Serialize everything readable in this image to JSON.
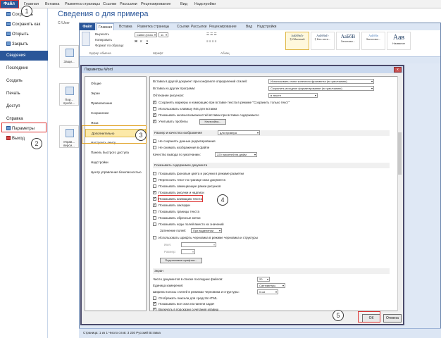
{
  "outer": {
    "file_tab": "Файл",
    "tabs": [
      "Главная",
      "Вставка",
      "Разметка страницы",
      "Ссылки",
      "Рассылки",
      "Рецензирование",
      "Вид",
      "Надстройки"
    ],
    "title": "Сведения о для примера",
    "path": "C:\\User",
    "nav": [
      "Сохранить",
      "Сохранить как",
      "Открыть",
      "Закрыть",
      "Сведения",
      "Последние",
      "Создать",
      "Печать",
      "Доступ",
      "Справка",
      "Параметры",
      "Выход"
    ],
    "cards": [
      "Защи...",
      "Пои... пробл...",
      "Управ... верси..."
    ]
  },
  "inner": {
    "file_tab": "Файл",
    "tabs": [
      "Главная",
      "Вставка",
      "Разметка страницы",
      "Ссылки",
      "Рассылки",
      "Рецензирование",
      "Вид",
      "Надстройки"
    ],
    "ribbon": {
      "cut": "Вырезать",
      "copy": "Копировать",
      "format_painter": "Формат по образцу",
      "font": "Calibri (Осно",
      "size": "11",
      "group_clipboard": "Буфер обмена",
      "group_font": "Шрифт",
      "group_paragraph": "Абзац",
      "styles": [
        {
          "sample": "АаБбВвГг",
          "name": "¶ Обычный"
        },
        {
          "sample": "АаБбВвГг",
          "name": "¶ Без инте..."
        },
        {
          "sample": "АаБбВ",
          "name": "Заголово..."
        },
        {
          "sample": "АаБбВв",
          "name": "Заголово..."
        },
        {
          "sample": "Аав",
          "name": "Название"
        }
      ]
    },
    "status": "Страница: 1 из 1    Число слов: 3 230    Русский    Вставка"
  },
  "dialog": {
    "title": "Параметры Word",
    "close": "x",
    "left_items": [
      "Общие",
      "Экран",
      "Правописание",
      "Сохранение",
      "Язык",
      "Дополнительно",
      "Настроить ленту",
      "Панель быстрого доступа",
      "Надстройки",
      "Центр управления безопасностью"
    ],
    "rows_top": [
      {
        "text": "Вставка в другой документ при конфликте определений стилей:",
        "dd": "Использовать стили конечного фрагмента (по умолчанию)",
        "checked": null
      },
      {
        "text": "Вставка из других программ:",
        "dd": "Сохранить исходное форматирование (по умолчанию)",
        "checked": null
      },
      {
        "text": "Обтекание рисунков:",
        "dd": "в тексте",
        "checked": null
      },
      {
        "text": "Сохранять маркеры и нумерацию при вставке текста в режиме \"Сохранить только текст\"",
        "checked": true
      },
      {
        "text": "Использовать клавишу INS для вставки",
        "checked": false
      },
      {
        "text": "Показывать кнопки возможностей вставки при вставке содержимого",
        "checked": true
      },
      {
        "text": "Учитывать пробелы",
        "checked": true
      }
    ],
    "settings_button": "Настройка...",
    "section_size": "Размер и качество изображения",
    "size_dd": "для примера",
    "rows_size": [
      {
        "text": "Не сохранять данные редактирования",
        "checked": false
      },
      {
        "text": "Не сжимать изображения в файле",
        "checked": false
      }
    ],
    "quality_label": "Качество вывода по умолчанию:",
    "quality_dd": "220 пикселей на дюйм",
    "section_show": "Показывать содержимое документа",
    "rows_show": [
      {
        "text": "Показывать фоновые цвета и рисунки в режиме разметки",
        "checked": false
      },
      {
        "text": "Переносить текст по границе окна документа",
        "checked": false
      },
      {
        "text": "Показывать замещающие рамки рисунков",
        "checked": false
      },
      {
        "text": "Показывать рисунки и надписи",
        "checked": true
      },
      {
        "text": "Показывать анимацию текста",
        "checked": true
      },
      {
        "text": "Показывать закладки",
        "checked": true
      },
      {
        "text": "Показывать границы текста",
        "checked": false
      },
      {
        "text": "Показывать обрезные метки",
        "checked": false
      },
      {
        "text": "Показывать коды полей вместо их значений",
        "checked": false
      }
    ],
    "shading_label": "Затенение полей:",
    "shading_dd": "При выделении",
    "draft_font": "Использовать шрифты черновика в режиме черновика и структуры",
    "draft_name": "Имя:",
    "draft_size": "Размер:",
    "font_sub_button": "Подстановка шрифтов...",
    "section_screen": "Экран",
    "recent_label": "Число документов в списке последних файлов:",
    "recent_value": "20",
    "units_label": "Единица измерения:",
    "units_dd": "Сантиметры",
    "width_label": "Ширина полосы стилей в режимах черновика и структуры:",
    "width_value": "0 см",
    "rows_screen": [
      {
        "text": "Отображать пиксели для средств HTML",
        "checked": false
      },
      {
        "text": "Показывать все окна на панели задач",
        "checked": true
      },
      {
        "text": "Включать в подсказки сочетания клавиш",
        "checked": true
      },
      {
        "text": "Показывать горизонтальную полосу прокрутки",
        "checked": true
      }
    ],
    "ok": "ОК",
    "cancel": "Отмена"
  },
  "callouts": [
    "1",
    "2",
    "3",
    "4",
    "5"
  ]
}
